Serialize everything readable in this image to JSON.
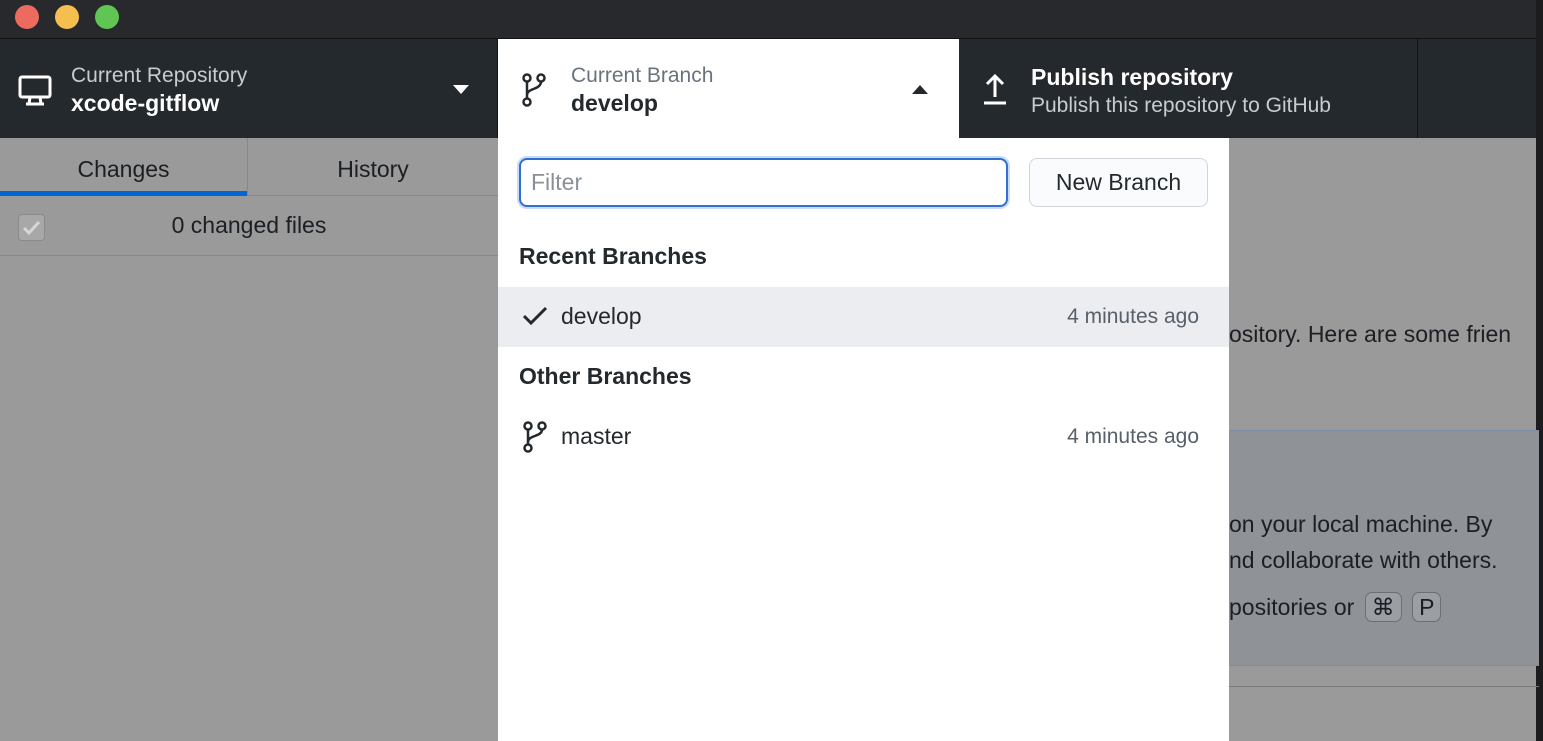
{
  "window": {
    "controls": [
      "close",
      "minimize",
      "maximize"
    ]
  },
  "toolbar": {
    "repository": {
      "label": "Current Repository",
      "name": "xcode-gitflow",
      "icon": "computer-icon",
      "chevron": "triangle-down-icon"
    },
    "branch": {
      "label": "Current Branch",
      "name": "develop",
      "icon": "git-branch-icon",
      "chevron": "triangle-up-icon"
    },
    "publish": {
      "title": "Publish repository",
      "subtitle": "Publish this repository to GitHub",
      "icon": "upload-icon"
    }
  },
  "sidebar": {
    "tabs": [
      {
        "label": "Changes",
        "active": true
      },
      {
        "label": "History",
        "active": false
      }
    ],
    "changed_files": "0 changed files"
  },
  "main": {
    "line1": "ository. Here are some frien",
    "line2": "on your local machine. By",
    "line3": "nd collaborate with others.",
    "line4": "positories or",
    "kbd1": "⌘",
    "kbd2": "P"
  },
  "branch_dropdown": {
    "filter_placeholder": "Filter",
    "filter_value": "",
    "new_branch_label": "New Branch",
    "recent_header": "Recent Branches",
    "recent": [
      {
        "name": "develop",
        "time": "4 minutes ago",
        "current": true
      }
    ],
    "other_header": "Other Branches",
    "other": [
      {
        "name": "master",
        "time": "4 minutes ago",
        "current": false
      }
    ]
  },
  "colors": {
    "accent": "#0366d6",
    "toolbar_bg": "#24292e",
    "close": "#ed6a5e",
    "minimize": "#f5bf4f",
    "maximize": "#61c554"
  }
}
